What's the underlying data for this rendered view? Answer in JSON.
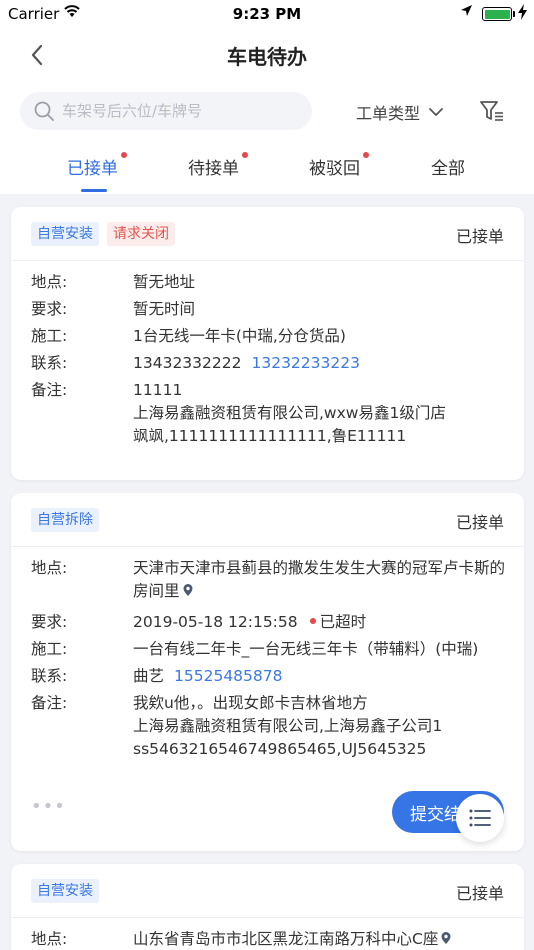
{
  "status_bar": {
    "carrier": "Carrier",
    "time": "9:23 PM",
    "icons": [
      "wifi-icon",
      "location-arrow-icon",
      "battery-icon",
      "charging-bolt-icon"
    ]
  },
  "nav": {
    "title": "车电待办",
    "back_icon": "chevron-left-icon"
  },
  "search": {
    "placeholder": "车架号后六位/车牌号",
    "value": ""
  },
  "filter": {
    "type_label": "工单类型",
    "filter_icon": "filter-list-icon"
  },
  "tabs": [
    {
      "label": "已接单",
      "active": true,
      "badge": true
    },
    {
      "label": "待接单",
      "active": false,
      "badge": true
    },
    {
      "label": "被驳回",
      "active": false,
      "badge": true
    },
    {
      "label": "全部",
      "active": false,
      "badge": false
    }
  ],
  "labels": {
    "address": "地点:",
    "requirement": "要求:",
    "construction": "施工:",
    "contact": "联系:",
    "remark": "备注:"
  },
  "cards": [
    {
      "tags": [
        "自营安装",
        "请求关闭"
      ],
      "status": "已接单",
      "address": "暂无地址",
      "requirement": "暂无时间",
      "construction": "1台无线一年卡(中瑞,分仓货品)",
      "contact_name": "13432332222",
      "contact_phone": "13232233223",
      "remark_lines": [
        "11111",
        "上海易鑫融资租赁有限公司,wxw易鑫1级门店",
        "飒飒,1111111111111111,鲁E11111"
      ]
    },
    {
      "tags": [
        "自营拆除"
      ],
      "status": "已接单",
      "address": "天津市天津市县蓟县的撒发生发生大赛的冠军卢卡斯的房间里",
      "requirement": "2019-05-18 12:15:58",
      "overdue": "已超时",
      "construction": "一台有线二年卡_一台无线三年卡（带辅料）(中瑞)",
      "contact_name": "曲艺",
      "contact_phone": "15525485878",
      "remark_lines": [
        "我欸u他，。出现女郎卡吉林省地方",
        "上海易鑫融资租赁有限公司,上海易鑫子公司1",
        "ss5463216546749865465,UJ5645325"
      ],
      "submit_label": "提交结",
      "more": "•••"
    },
    {
      "tags": [
        "自营安装"
      ],
      "status": "已接单",
      "address": "山东省青岛市市北区黑龙江南路万科中心C座"
    }
  ],
  "fab_icon": "list-menu-icon",
  "colors": {
    "accent": "#2f6de1",
    "badge_red": "#e5484d",
    "tag_blue_bg": "#eaf1fd",
    "tag_red_bg": "#fdecec",
    "battery_green": "#2bb24c"
  }
}
